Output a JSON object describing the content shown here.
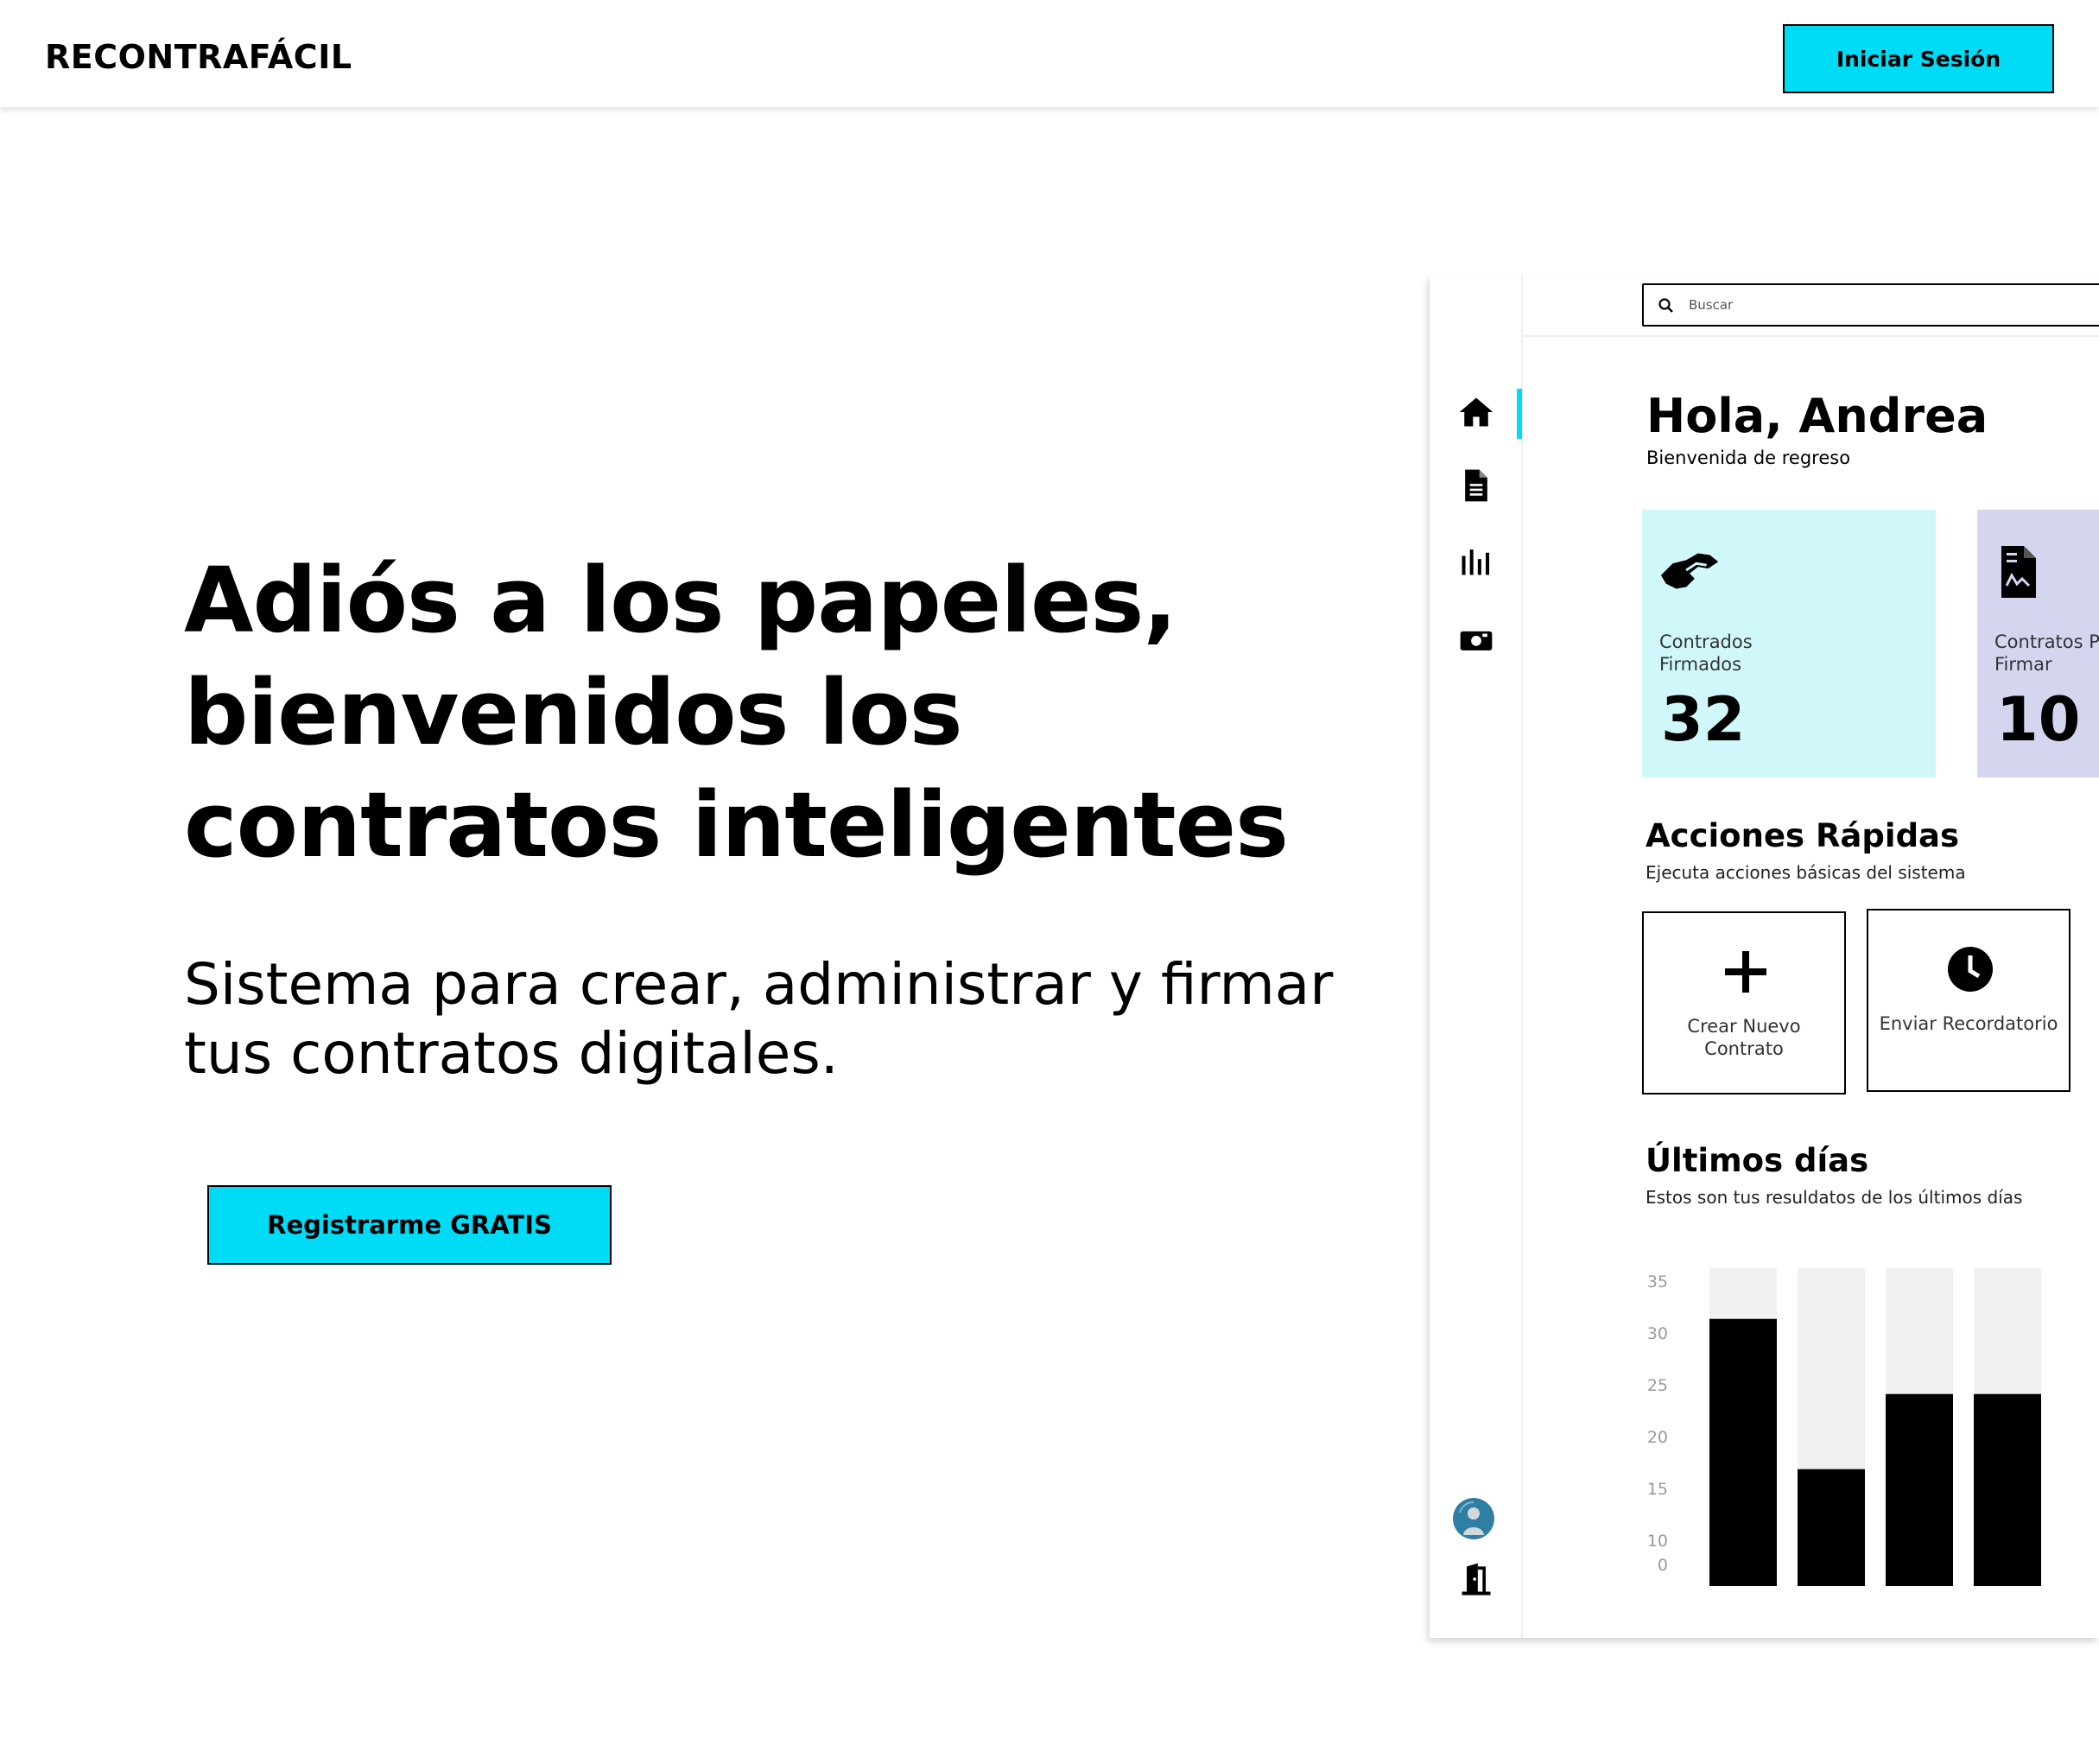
{
  "header": {
    "brand": "RECONTRAFÁCIL",
    "login_label": "Iniciar Sesión"
  },
  "hero": {
    "title": "Adiós a los papeles, bienvenidos los contratos inteligentes",
    "subtitle": "Sistema para crear, administrar y firmar tus contratos digitales.",
    "cta_label": "Registrarme GRATIS"
  },
  "colors": {
    "accent": "#00dcf5",
    "card_signed_bg": "#d0f8fb",
    "card_pending_bg": "#d3d6ee"
  },
  "dashboard": {
    "search": {
      "placeholder": "Buscar"
    },
    "sidebar_icons": [
      "home-icon",
      "document-icon",
      "chart-icon",
      "camera-icon",
      "avatar",
      "logout-door-icon"
    ],
    "greeting": "Hola, Andrea",
    "greeting_sub": "Bienvenida de regreso",
    "cards": [
      {
        "label": "Contrados Firmados",
        "value": "32",
        "icon": "handshake-icon"
      },
      {
        "label": "Contratos P de Firmar",
        "value": "10",
        "icon": "signed-document-icon"
      }
    ],
    "quick_actions": {
      "title": "Acciones Rápidas",
      "subtitle": "Ejecuta acciones básicas del sistema",
      "items": [
        {
          "label": "Crear Nuevo Contrato",
          "icon": "plus-icon"
        },
        {
          "label": "Enviar Recordatorio",
          "icon": "clock-icon"
        }
      ]
    },
    "recent": {
      "title": "Últimos días",
      "subtitle": "Estos son tus resuldatos de los últimos días"
    }
  },
  "chart_data": {
    "type": "bar",
    "ytick_labels": [
      "35",
      "30",
      "25",
      "20",
      "15",
      "10",
      "0"
    ],
    "ylim": [
      0,
      35
    ],
    "values": [
      32,
      14,
      23,
      23
    ],
    "colors": {
      "bar": "#000000",
      "track": "#f1f1f1",
      "tick": "#9a9a9a"
    }
  }
}
